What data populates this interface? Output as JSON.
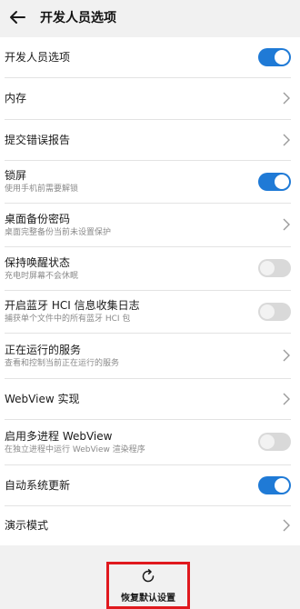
{
  "header": {
    "title": "开发人员选项"
  },
  "settings": [
    {
      "title": "开发人员选项",
      "subtitle": "",
      "control": "switch",
      "state": "on"
    },
    {
      "title": "内存",
      "subtitle": "",
      "control": "chevron"
    },
    {
      "title": "提交错误报告",
      "subtitle": "",
      "control": "chevron"
    },
    {
      "title": "锁屏",
      "subtitle": "使用手机前需要解锁",
      "control": "switch",
      "state": "on"
    },
    {
      "title": "桌面备份密码",
      "subtitle": "桌面完整备份当前未设置保护",
      "control": "chevron"
    },
    {
      "title": "保持唤醒状态",
      "subtitle": "充电时屏幕不会休眠",
      "control": "switch",
      "state": "off"
    },
    {
      "title": "开启蓝牙 HCI 信息收集日志",
      "subtitle": "捕获单个文件中的所有蓝牙 HCI 包",
      "control": "switch",
      "state": "off"
    },
    {
      "title": "正在运行的服务",
      "subtitle": "查看和控制当前正在运行的服务",
      "control": "chevron"
    },
    {
      "title": "WebView 实现",
      "subtitle": "",
      "control": "chevron"
    },
    {
      "title": "启用多进程 WebView",
      "subtitle": "在独立进程中运行 WebView 渲染程序",
      "control": "switch",
      "state": "off"
    },
    {
      "title": "自动系统更新",
      "subtitle": "",
      "control": "switch",
      "state": "on"
    },
    {
      "title": "演示模式",
      "subtitle": "",
      "control": "chevron"
    }
  ],
  "footer": {
    "reset_label": "恢复默认设置"
  },
  "colors": {
    "accent": "#1f7ad6",
    "highlight": "#e0191e",
    "background": "#f1f1f1"
  },
  "icons": {
    "back": "back-arrow-icon",
    "chevron": "chevron-right-icon",
    "reset": "refresh-icon"
  }
}
